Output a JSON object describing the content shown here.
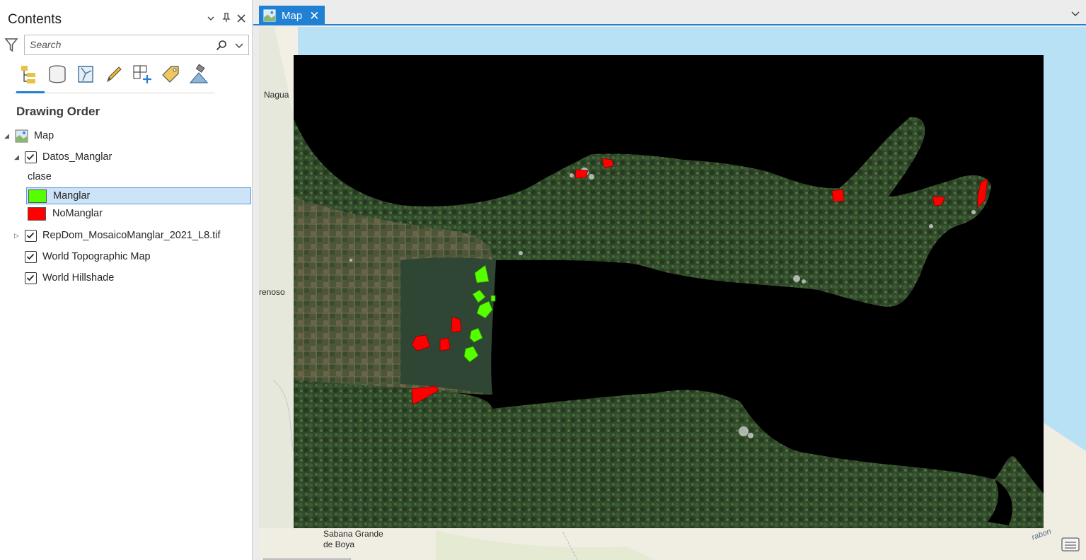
{
  "contents_pane": {
    "title": "Contents",
    "search_placeholder": "Search",
    "toolbar_icons": [
      "list-by-drawing-order-icon",
      "list-by-data-source-icon",
      "list-by-selection-icon",
      "list-by-editing-icon",
      "list-by-snapping-icon",
      "list-by-labeling-icon",
      "list-by-perspective-imagery-icon"
    ],
    "section_title": "Drawing Order",
    "tree": {
      "map": "Map",
      "datos_layer": "Datos_Manglar",
      "field_heading": "clase",
      "legend": [
        {
          "label": "Manglar",
          "color": "#55ff00"
        },
        {
          "label": "NoManglar",
          "color": "#ff0000"
        }
      ],
      "raster_layer": "RepDom_MosaicoManglar_2021_L8.tif",
      "topo_layer": "World Topographic Map",
      "hillshade_layer": "World Hillshade"
    }
  },
  "map_view": {
    "tab_label": "Map",
    "place_labels": {
      "nagua": "Nagua",
      "arenoso": "renoso",
      "sabana": "Sabana Grande\nde Boya",
      "rabon": "rabon"
    },
    "colors": {
      "ocean": "#b9e1f6",
      "land": "#f2efe6",
      "raster_background": "#000000",
      "vegetation": "#2f4a2a"
    }
  }
}
